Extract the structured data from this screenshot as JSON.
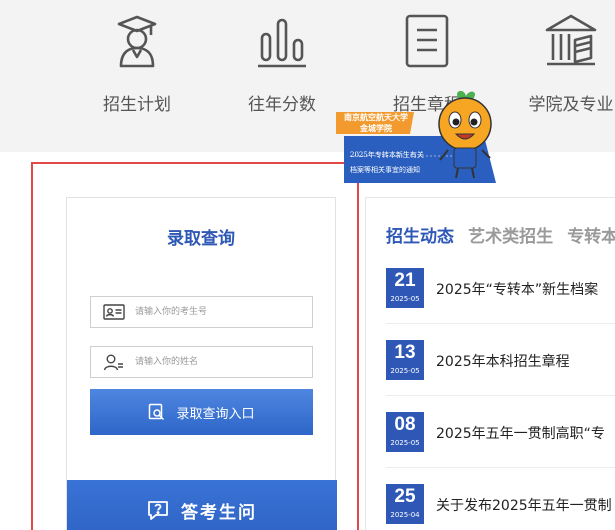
{
  "nav": {
    "items": [
      {
        "label": "招生计划",
        "icon": "graduate-icon"
      },
      {
        "label": "往年分数",
        "icon": "bar-chart-icon"
      },
      {
        "label": "招生章程",
        "icon": "document-icon"
      },
      {
        "label": "学院及专业",
        "icon": "building-icon"
      }
    ]
  },
  "badge": {
    "school_line1": "南京航空航天大学",
    "school_line2": "金城学院",
    "notice_line1": "2025年专转本新生有关",
    "notice_line2": "档案等相关事宜的通知"
  },
  "query": {
    "title": "录取查询",
    "exam_no_placeholder": "请输入你的考生号",
    "name_placeholder": "请输入你的姓名",
    "submit_label": "录取查询入口",
    "qa_label": "答考生问"
  },
  "news": {
    "tabs": [
      "招生动态",
      "艺术类招生",
      "专转本"
    ],
    "items": [
      {
        "day": "21",
        "ym": "2025-05",
        "title": "2025年“专转本”新生档案"
      },
      {
        "day": "13",
        "ym": "2025-05",
        "title": "2025年本科招生章程"
      },
      {
        "day": "08",
        "ym": "2025-05",
        "title": "2025年五年一贯制高职“专"
      },
      {
        "day": "25",
        "ym": "2025-04",
        "title": "关于发布2025年五年一贯制"
      }
    ]
  },
  "colors": {
    "brand": "#2f58b6",
    "selection": "#e34848",
    "banner": "#2b5fbf",
    "badge_orange": "#f29a2e"
  }
}
